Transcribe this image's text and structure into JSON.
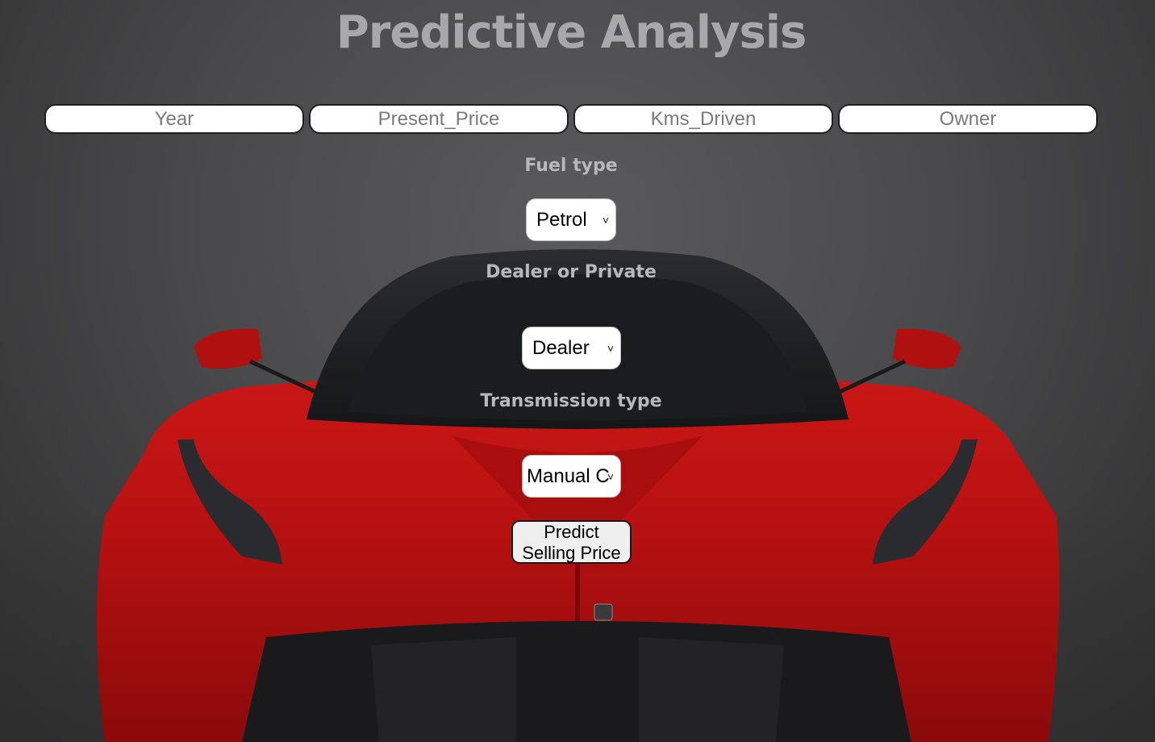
{
  "page": {
    "title": "Predictive Analysis"
  },
  "inputs": {
    "year_placeholder": "Year",
    "present_price_placeholder": "Present_Price",
    "kms_driven_placeholder": "Kms_Driven",
    "owner_placeholder": "Owner"
  },
  "fuel": {
    "label": "Fuel type",
    "selected": "Petrol"
  },
  "seller": {
    "label": "Dealer or Private",
    "selected": "Dealer"
  },
  "transmission": {
    "label": "Transmission type",
    "selected": "Manual C"
  },
  "predict": {
    "line1": "Predict",
    "line2": "Selling Price"
  },
  "colors": {
    "background": "#4a4a4c",
    "car_body": "#c41414",
    "title_text": "#a8a8ac",
    "label_text": "#b8b8bc"
  },
  "icons": {
    "dropdown": "chevron-down-icon"
  }
}
